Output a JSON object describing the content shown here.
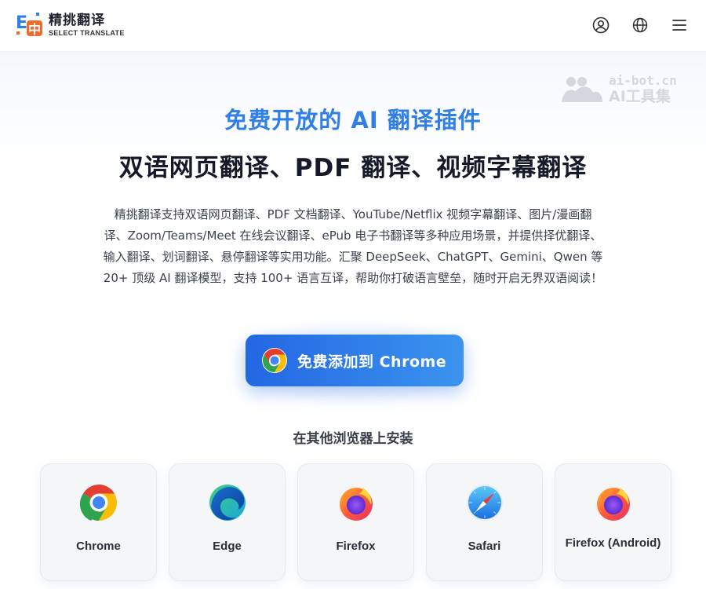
{
  "header": {
    "logo_title": "精挑翻译",
    "logo_subtitle": "SELECT TRANSLATE",
    "icons": [
      "user-icon",
      "globe-icon",
      "menu-icon"
    ]
  },
  "watermark": {
    "url": "ai-bot.cn",
    "name": "AI工具集"
  },
  "hero": {
    "subtitle": "免费开放的 AI 翻译插件",
    "title": "双语网页翻译、PDF 翻译、视频字幕翻译",
    "description_lines": [
      "精挑翻译支持双语网页翻译、PDF 文档翻译、YouTube/Netflix 视频字幕翻译、图片/漫画翻",
      "译、Zoom/Teams/Meet 在线会议翻译、ePub 电子书翻译等多种应用场景，并提供择优翻译、",
      "输入翻译、划词翻译、悬停翻译等实用功能。汇聚 DeepSeek、ChatGPT、Gemini、Qwen 等",
      "20+ 顶级 AI 翻译模型，支持 100+ 语言互译，帮助你打破语言壁垒，随时开启无界双语阅读！"
    ],
    "cta_label": "免费添加到 Chrome"
  },
  "install": {
    "title": "在其他浏览器上安装",
    "browsers": [
      {
        "label": "Chrome",
        "icon": "chrome-icon"
      },
      {
        "label": "Edge",
        "icon": "edge-icon"
      },
      {
        "label": "Firefox",
        "icon": "firefox-icon"
      },
      {
        "label": "Safari",
        "icon": "safari-icon"
      },
      {
        "label": "Firefox (Android)",
        "icon": "firefox-icon"
      }
    ]
  },
  "colors": {
    "accent_blue": "#2f7fe6",
    "cta_start": "#2367e3",
    "cta_end": "#3b93ee",
    "title_dark": "#16192a"
  }
}
